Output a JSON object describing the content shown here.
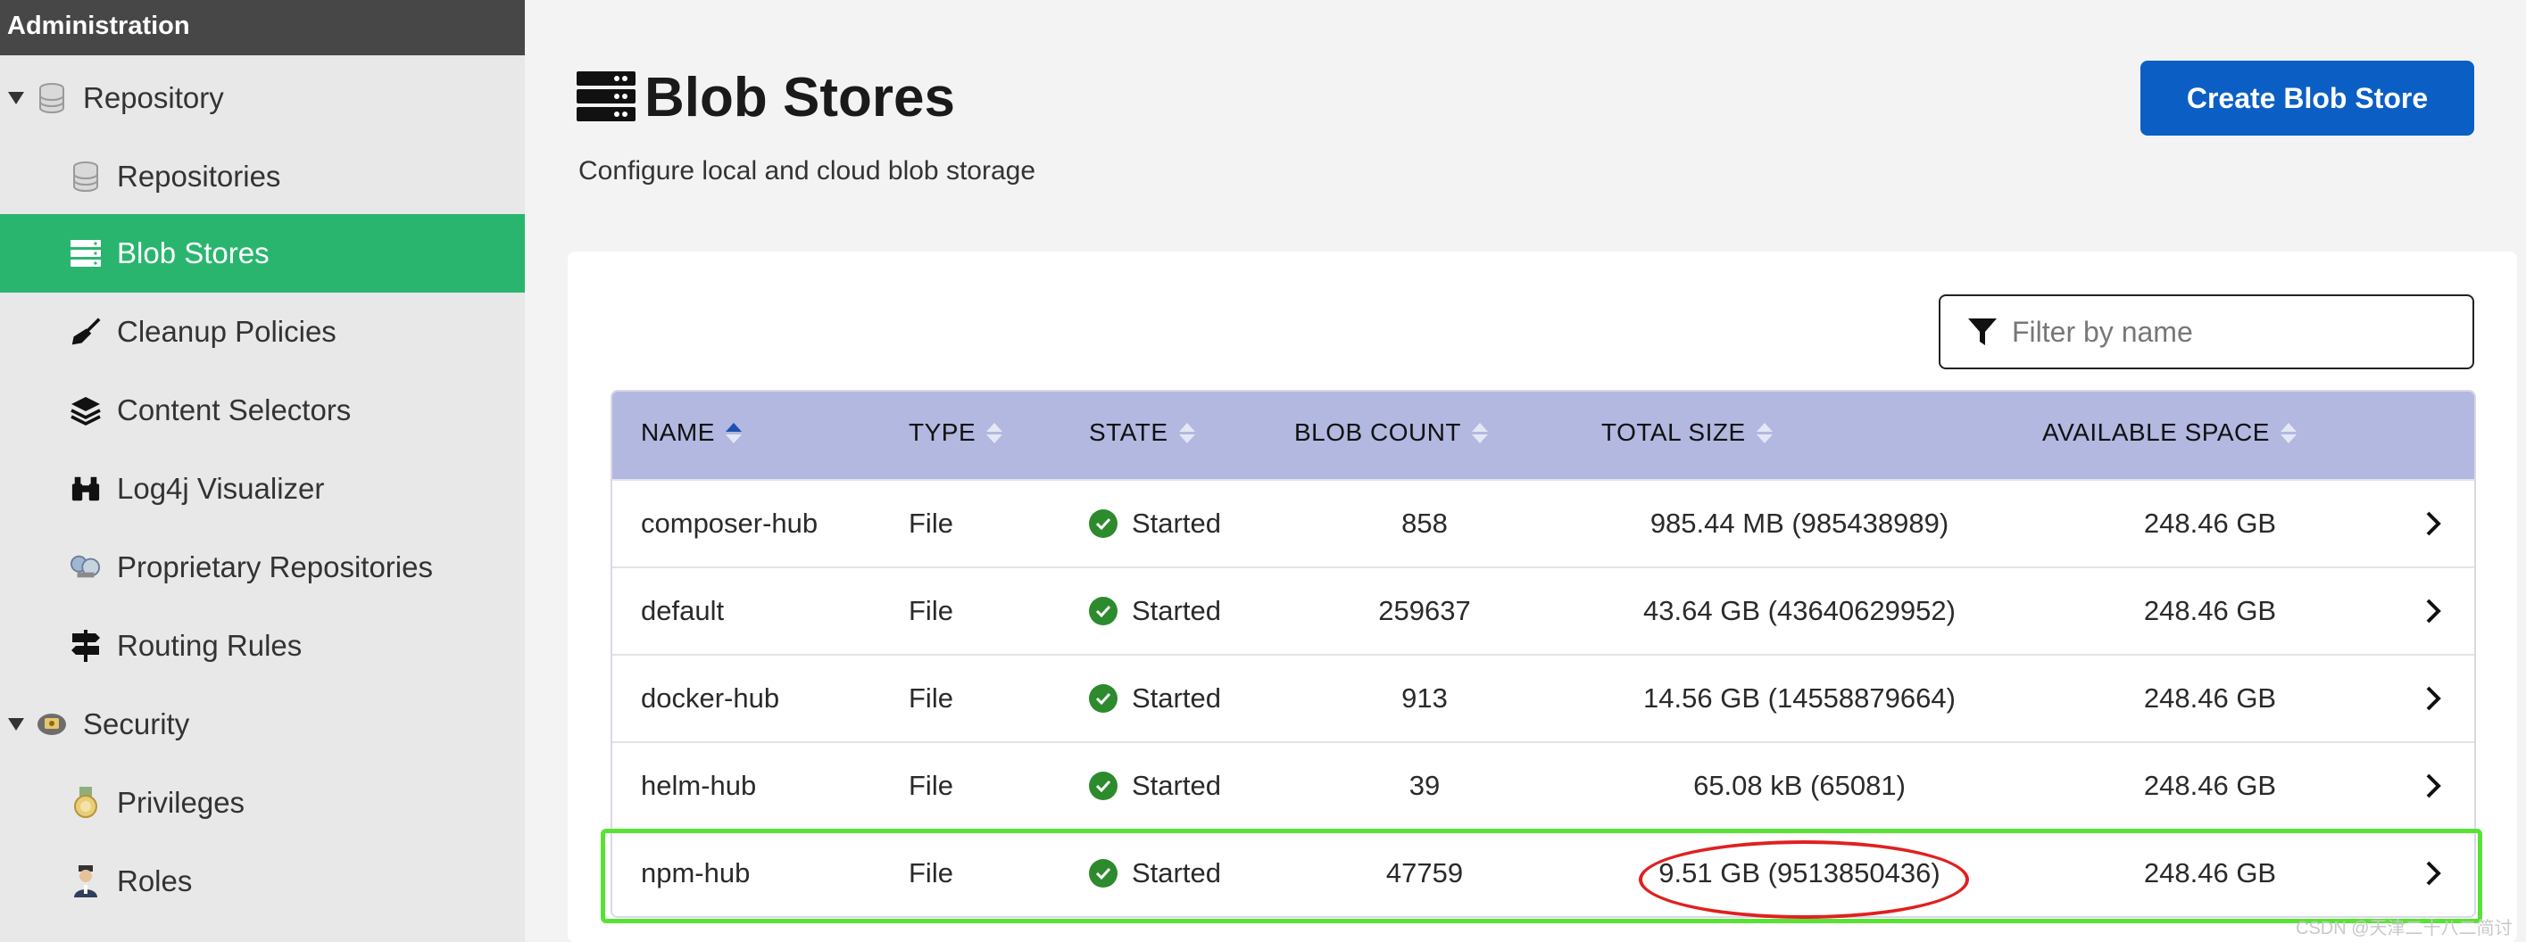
{
  "sidebar": {
    "header": "Administration",
    "items": [
      {
        "label": "Repository",
        "icon": "database-icon",
        "active": false
      },
      {
        "label": "Repositories",
        "icon": "database-icon",
        "active": false
      },
      {
        "label": "Blob Stores",
        "icon": "server-icon",
        "active": true
      },
      {
        "label": "Cleanup Policies",
        "icon": "broom-icon",
        "active": false
      },
      {
        "label": "Content Selectors",
        "icon": "layers-icon",
        "active": false
      },
      {
        "label": "Log4j Visualizer",
        "icon": "binoculars-icon",
        "active": false
      },
      {
        "label": "Proprietary Repositories",
        "icon": "globe-icon",
        "active": false
      },
      {
        "label": "Routing Rules",
        "icon": "signpost-icon",
        "active": false
      },
      {
        "label": "Security",
        "icon": "badge-icon",
        "active": false
      },
      {
        "label": "Privileges",
        "icon": "medal-icon",
        "active": false
      },
      {
        "label": "Roles",
        "icon": "user-role-icon",
        "active": false
      }
    ]
  },
  "page": {
    "title": "Blob Stores",
    "subtitle": "Configure local and cloud blob storage",
    "create_button": "Create Blob Store"
  },
  "filter": {
    "placeholder": "Filter by name"
  },
  "table": {
    "headers": [
      "NAME",
      "TYPE",
      "STATE",
      "BLOB COUNT",
      "TOTAL SIZE",
      "AVAILABLE SPACE"
    ],
    "sorted_column": "NAME",
    "rows": [
      {
        "name": "composer-hub",
        "type": "File",
        "state": "Started",
        "blob_count": "858",
        "total_size": "985.44 MB (985438989)",
        "available": "248.46 GB"
      },
      {
        "name": "default",
        "type": "File",
        "state": "Started",
        "blob_count": "259637",
        "total_size": "43.64 GB (43640629952)",
        "available": "248.46 GB"
      },
      {
        "name": "docker-hub",
        "type": "File",
        "state": "Started",
        "blob_count": "913",
        "total_size": "14.56 GB (14558879664)",
        "available": "248.46 GB"
      },
      {
        "name": "helm-hub",
        "type": "File",
        "state": "Started",
        "blob_count": "39",
        "total_size": "65.08 kB (65081)",
        "available": "248.46 GB"
      },
      {
        "name": "npm-hub",
        "type": "File",
        "state": "Started",
        "blob_count": "47759",
        "total_size": "9.51 GB (9513850436)",
        "available": "248.46 GB"
      }
    ]
  },
  "colors": {
    "active_green": "#2ab56f",
    "primary_blue": "#0b5fc4",
    "header_lavender": "#b2b8e0",
    "highlight_green": "#58e334",
    "highlight_red": "#e02020"
  },
  "watermark": "CSDN @天津二十八二简讨人"
}
